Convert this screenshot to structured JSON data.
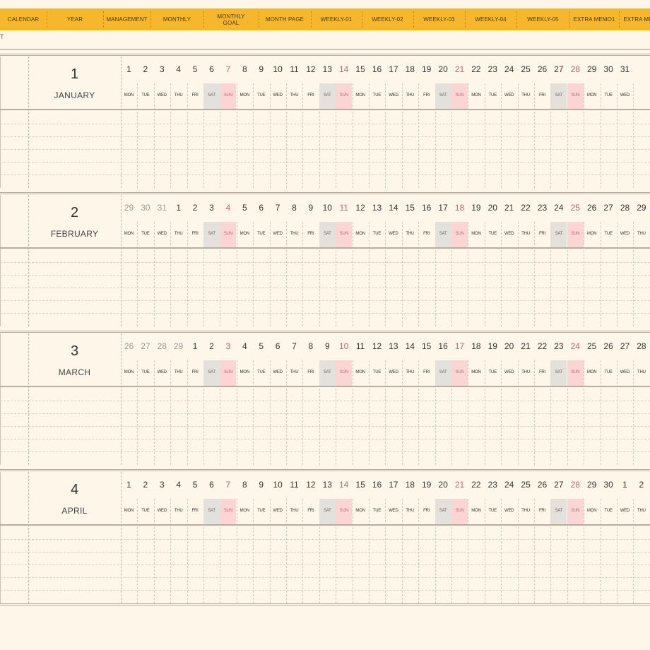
{
  "nav": {
    "tabs": [
      {
        "label": "CALENDAR"
      },
      {
        "label": "YEAR"
      },
      {
        "label": "MANAGEMENT"
      },
      {
        "label": "MONTHLY"
      },
      {
        "label": "MONTHLY\nGOAL"
      },
      {
        "label": "MONTH PAGE"
      },
      {
        "label": "WEEKLY-01"
      },
      {
        "label": "WEEKLY-02"
      },
      {
        "label": "WEEKLY-03"
      },
      {
        "label": "WEEKLY-04"
      },
      {
        "label": "WEEKLY-05"
      },
      {
        "label": "EXTRA MEMO1"
      },
      {
        "label": "EXTRA ME"
      }
    ]
  },
  "top_fragment": "T",
  "weekdays": [
    "MON",
    "TUE",
    "WED",
    "THU",
    "FRI",
    "SAT",
    "SUN"
  ],
  "months": [
    {
      "number": "1",
      "name": "JANUARY",
      "days": [
        {
          "d": "1"
        },
        {
          "d": "2"
        },
        {
          "d": "3"
        },
        {
          "d": "4"
        },
        {
          "d": "5"
        },
        {
          "d": "6"
        },
        {
          "d": "7"
        },
        {
          "d": "8"
        },
        {
          "d": "9"
        },
        {
          "d": "10"
        },
        {
          "d": "11"
        },
        {
          "d": "12"
        },
        {
          "d": "13"
        },
        {
          "d": "14"
        },
        {
          "d": "15"
        },
        {
          "d": "16"
        },
        {
          "d": "17"
        },
        {
          "d": "18"
        },
        {
          "d": "19"
        },
        {
          "d": "20"
        },
        {
          "d": "21"
        },
        {
          "d": "22"
        },
        {
          "d": "23"
        },
        {
          "d": "24"
        },
        {
          "d": "25"
        },
        {
          "d": "26"
        },
        {
          "d": "27"
        },
        {
          "d": "28"
        },
        {
          "d": "29"
        },
        {
          "d": "30"
        },
        {
          "d": "31"
        }
      ]
    },
    {
      "number": "2",
      "name": "FEBRUARY",
      "days": [
        {
          "d": "29",
          "other": true
        },
        {
          "d": "30",
          "other": true
        },
        {
          "d": "31",
          "other": true
        },
        {
          "d": "1"
        },
        {
          "d": "2"
        },
        {
          "d": "3"
        },
        {
          "d": "4"
        },
        {
          "d": "5"
        },
        {
          "d": "6"
        },
        {
          "d": "7"
        },
        {
          "d": "8"
        },
        {
          "d": "9"
        },
        {
          "d": "10"
        },
        {
          "d": "11"
        },
        {
          "d": "12"
        },
        {
          "d": "13"
        },
        {
          "d": "14"
        },
        {
          "d": "15"
        },
        {
          "d": "16"
        },
        {
          "d": "17"
        },
        {
          "d": "18"
        },
        {
          "d": "19"
        },
        {
          "d": "20"
        },
        {
          "d": "21"
        },
        {
          "d": "22"
        },
        {
          "d": "23"
        },
        {
          "d": "24"
        },
        {
          "d": "25"
        },
        {
          "d": "26"
        },
        {
          "d": "27"
        },
        {
          "d": "28"
        },
        {
          "d": "29"
        }
      ]
    },
    {
      "number": "3",
      "name": "MARCH",
      "days": [
        {
          "d": "26",
          "other": true
        },
        {
          "d": "27",
          "other": true
        },
        {
          "d": "28",
          "other": true
        },
        {
          "d": "29",
          "other": true
        },
        {
          "d": "1"
        },
        {
          "d": "2"
        },
        {
          "d": "3"
        },
        {
          "d": "4"
        },
        {
          "d": "5"
        },
        {
          "d": "6"
        },
        {
          "d": "7"
        },
        {
          "d": "8"
        },
        {
          "d": "9"
        },
        {
          "d": "10"
        },
        {
          "d": "11"
        },
        {
          "d": "12"
        },
        {
          "d": "13"
        },
        {
          "d": "14"
        },
        {
          "d": "15"
        },
        {
          "d": "16"
        },
        {
          "d": "17"
        },
        {
          "d": "18"
        },
        {
          "d": "19"
        },
        {
          "d": "20"
        },
        {
          "d": "21"
        },
        {
          "d": "22"
        },
        {
          "d": "23"
        },
        {
          "d": "24"
        },
        {
          "d": "25"
        },
        {
          "d": "26"
        },
        {
          "d": "27"
        },
        {
          "d": "28"
        }
      ]
    },
    {
      "number": "4",
      "name": "APRIL",
      "days": [
        {
          "d": "1"
        },
        {
          "d": "2"
        },
        {
          "d": "3"
        },
        {
          "d": "4"
        },
        {
          "d": "5"
        },
        {
          "d": "6"
        },
        {
          "d": "7"
        },
        {
          "d": "8"
        },
        {
          "d": "9"
        },
        {
          "d": "10"
        },
        {
          "d": "11"
        },
        {
          "d": "12"
        },
        {
          "d": "13"
        },
        {
          "d": "14"
        },
        {
          "d": "15"
        },
        {
          "d": "16"
        },
        {
          "d": "17"
        },
        {
          "d": "18"
        },
        {
          "d": "19"
        },
        {
          "d": "20"
        },
        {
          "d": "21"
        },
        {
          "d": "22"
        },
        {
          "d": "23"
        },
        {
          "d": "24"
        },
        {
          "d": "25"
        },
        {
          "d": "26"
        },
        {
          "d": "27"
        },
        {
          "d": "28"
        },
        {
          "d": "29"
        },
        {
          "d": "30"
        },
        {
          "d": "1"
        },
        {
          "d": "2"
        }
      ]
    }
  ],
  "colors": {
    "tab_bar": "#f7b72c",
    "background": "#fdf6e9",
    "sunday_text": "#e05a6d",
    "sunday_fill": "#fbd4d4",
    "saturday_fill": "#e4e1dc",
    "rule": "#b7aea2"
  }
}
